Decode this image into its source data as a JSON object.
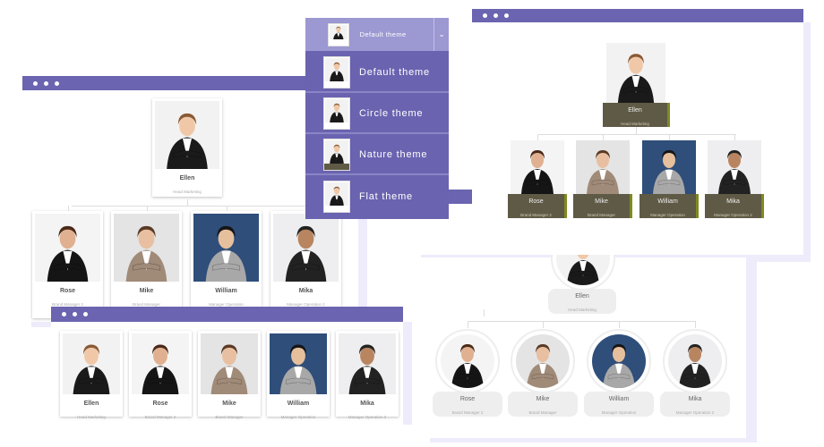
{
  "people": [
    {
      "name": "Ellen",
      "role": "Head Marketing",
      "bg": "#f2f2f2",
      "suit": "#1a1a1a",
      "hair": "#8a5a35",
      "skin": "#f0c8a8"
    },
    {
      "name": "Rose",
      "role": "Brand Manager 2",
      "bg": "#f4f4f4",
      "suit": "#151515",
      "hair": "#4a2a18",
      "skin": "#e0b090"
    },
    {
      "name": "Mike",
      "role": "Brand Manager",
      "bg": "#e4e4e4",
      "suit": "#a08a78",
      "hair": "#5a3a25",
      "skin": "#e8bfa0"
    },
    {
      "name": "William",
      "role": "Manager Operation",
      "bg": "#2f4e7a",
      "suit": "#a8a8a8",
      "hair": "#151515",
      "skin": "#e6bf9c"
    },
    {
      "name": "Mika",
      "role": "Manager Operation 2",
      "bg": "#eeeef0",
      "suit": "#222",
      "hair": "#222",
      "skin": "#b88560"
    }
  ],
  "dropdown": {
    "selected": "Default theme",
    "options": [
      {
        "label": "Default theme"
      },
      {
        "label": "Circle theme"
      },
      {
        "label": "Nature theme"
      },
      {
        "label": "Flat theme"
      }
    ]
  },
  "colors": {
    "accent": "#6b64b0",
    "nature": "#5f5a45",
    "nature_edge": "#7f8a20"
  }
}
